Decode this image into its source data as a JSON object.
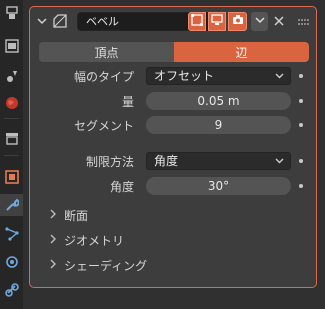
{
  "sidebar": {
    "icons": [
      "render-icon",
      "output-icon",
      "view-layer-icon",
      "world-icon",
      "collection-icon",
      "object-icon",
      "modifier-icon",
      "particles-icon",
      "physics-icon",
      "constraints-icon"
    ]
  },
  "modifier": {
    "name": "ベベル",
    "affect_tabs": [
      "頂点",
      "辺"
    ],
    "active_tab_index": 1,
    "fields": {
      "width_type_label": "幅のタイプ",
      "width_type_value": "オフセット",
      "amount_label": "量",
      "amount_value": "0.05 m",
      "segments_label": "セグメント",
      "segments_value": "9",
      "limit_method_label": "制限方法",
      "limit_method_value": "角度",
      "angle_label": "角度",
      "angle_value": "30°"
    },
    "subpanels": [
      "断面",
      "ジオメトリ",
      "シェーディング"
    ]
  },
  "colors": {
    "accent": "#d9643f",
    "panel_border": "#d96b53",
    "background": "#303030"
  }
}
